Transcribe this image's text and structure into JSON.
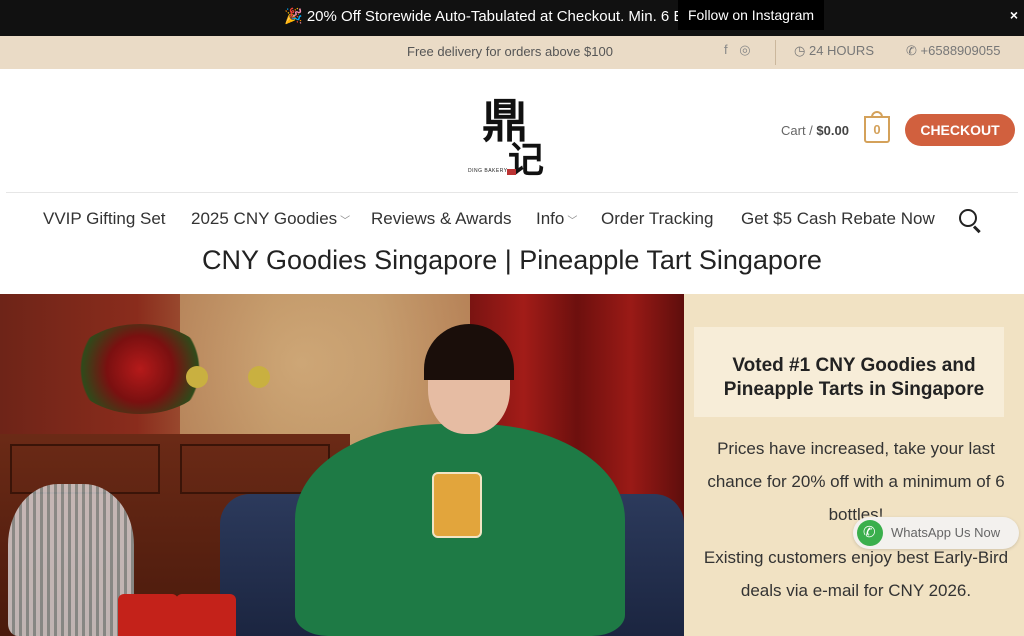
{
  "promo": {
    "text": "🎉 20% Off Storewide Auto-Tabulated at Checkout. Min. 6 E",
    "tooltip": "Follow on Instagram",
    "close": "×"
  },
  "topbar": {
    "delivery": "Free delivery for orders above $100",
    "facebook_icon": "f",
    "instagram_icon": "◎",
    "hours": "24 HOURS",
    "phone": "+6588909055"
  },
  "header": {
    "logo": {
      "big_char": "鼎",
      "small_char": "记",
      "brand": "DING BAKERY"
    },
    "cart_label": "Cart / ",
    "cart_total": "$0.00",
    "cart_count": "0",
    "checkout_label": "CHECKOUT"
  },
  "nav": {
    "items": [
      {
        "label": "VVIP Gifting Set"
      },
      {
        "label": "2025 CNY Goodies",
        "caret": "﹀"
      },
      {
        "label": "Reviews & Awards"
      },
      {
        "label": "Info",
        "caret": "﹀"
      },
      {
        "label": "Order Tracking"
      },
      {
        "label": "Get $5 Cash Rebate Now"
      }
    ]
  },
  "page_title": "CNY Goodies Singapore | Pineapple Tart Singapore",
  "side": {
    "voted_line1": "Voted #1 CNY Goodies and",
    "voted_line2": "Pineapple Tarts  in Singapore",
    "prices": "Prices have increased, take your last chance for 20% off with a minimum of 6 bottles!",
    "existing": "Existing customers enjoy best Early-Bird deals via e-mail for CNY 2026."
  },
  "whatsapp": {
    "label": "WhatsApp Us Now"
  },
  "colors": {
    "accent": "#d1603e",
    "gold": "#d4a15a",
    "beige": "#eadbc6",
    "panel": "#f1e2c3"
  }
}
